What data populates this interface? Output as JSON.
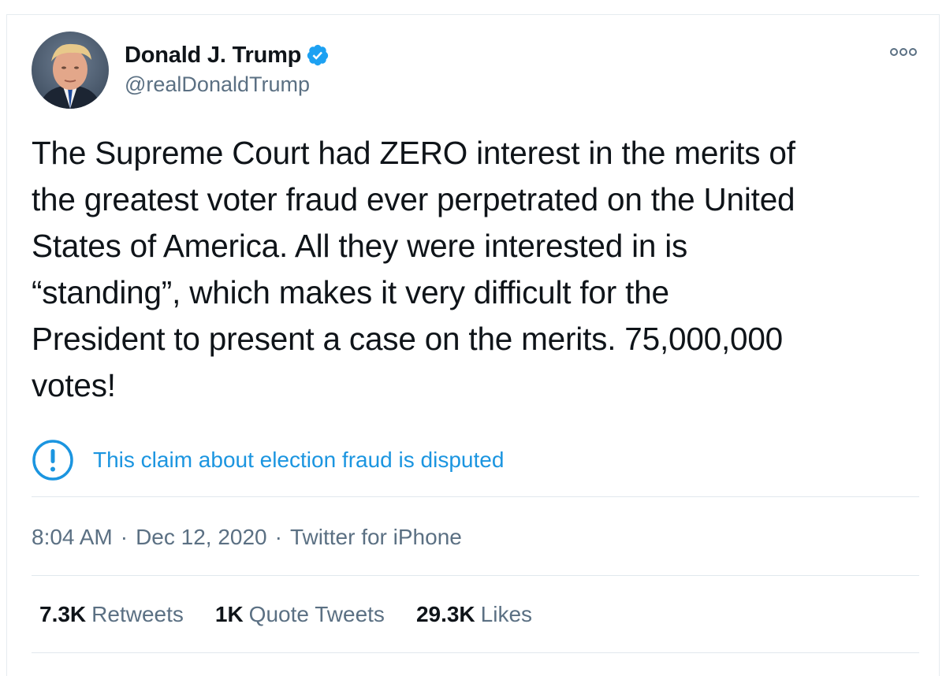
{
  "tweet": {
    "author": {
      "display_name": "Donald J. Trump",
      "handle": "@realDonaldTrump",
      "verified": true,
      "avatar_icon": "profile-photo"
    },
    "more_icon": "more-options-icon",
    "text_lines": [
      "The Supreme Court had ZERO interest in the merits of",
      "the greatest voter fraud ever perpetrated on the United",
      "States of America. All they were interested in is",
      "“standing”, which makes it very difficult for the",
      "President to present a case on the merits. 75,000,000",
      "votes!"
    ],
    "dispute_notice": {
      "icon": "exclamation-circle-icon",
      "label": "This claim about election fraud is disputed"
    },
    "meta": {
      "time": "8:04 AM",
      "separator": "·",
      "date": "Dec 12, 2020",
      "source": "Twitter for iPhone"
    },
    "stats": {
      "retweets_count": "7.3K",
      "retweets_label": "Retweets",
      "quotes_count": "1K",
      "quotes_label": "Quote Tweets",
      "likes_count": "29.3K",
      "likes_label": "Likes"
    }
  },
  "colors": {
    "text": "#0f1419",
    "secondary": "#5b7083",
    "accent": "#1b95e0",
    "divider": "#e1e8ed"
  }
}
